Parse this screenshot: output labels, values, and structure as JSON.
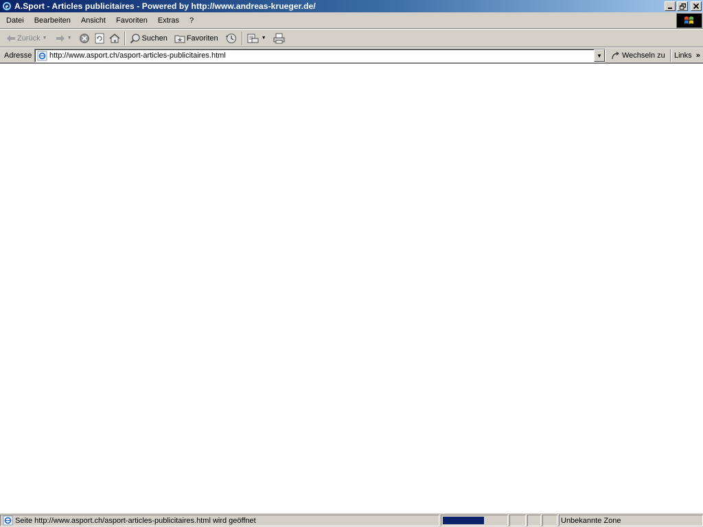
{
  "window": {
    "title": "A.Sport - Articles publicitaires - Powered by http://www.andreas-krueger.de/",
    "app_icon": "ie-icon",
    "controls": [
      "minimize-icon",
      "restore-icon",
      "close-icon"
    ]
  },
  "menubar": {
    "items": [
      "Datei",
      "Bearbeiten",
      "Ansicht",
      "Favoriten",
      "Extras",
      "?"
    ],
    "logo": "windows-flag-icon"
  },
  "toolbar": {
    "back_label": "Zurück",
    "search_label": "Suchen",
    "favorites_label": "Favoriten",
    "icons": [
      "back-arrow-icon",
      "forward-arrow-icon",
      "stop-icon",
      "refresh-icon",
      "home-icon",
      "search-icon",
      "favorites-icon",
      "history-icon",
      "mail-icon",
      "print-icon"
    ]
  },
  "addressbar": {
    "label": "Adresse",
    "url": "http://www.asport.ch/asport-articles-publicitaires.html",
    "go_label": "Wechseln zu",
    "links_label": "Links",
    "links_chevron": "»"
  },
  "statusbar": {
    "message": "Seite http://www.asport.ch/asport-articles-publicitaires.html wird geöffnet",
    "progress_percent": 65,
    "zone": "Unbekannte Zone"
  },
  "colors": {
    "title_active": "#0a246a",
    "chrome": "#d4d0c8",
    "progress": "#0a246a",
    "content_bg": "#ffffff"
  }
}
